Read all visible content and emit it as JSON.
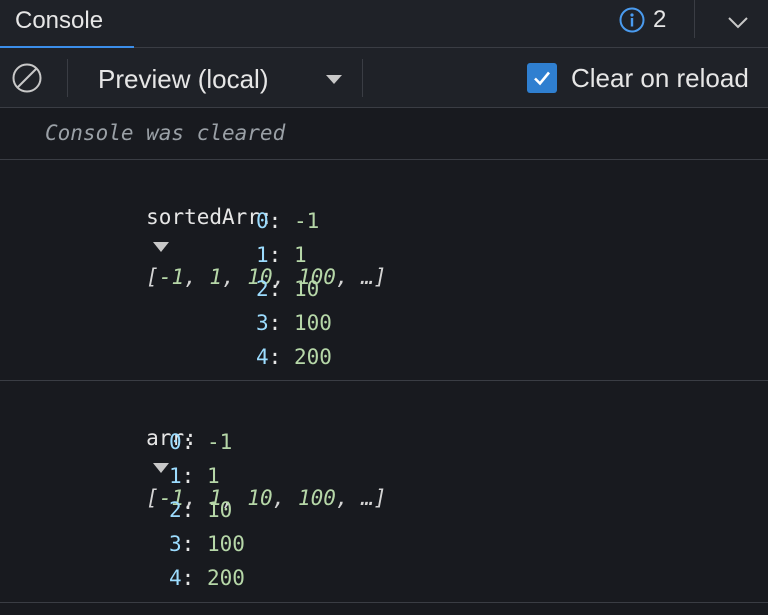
{
  "tabbar": {
    "tab_label": "Console",
    "issues_count": "2",
    "accent_color": "#3b8eea"
  },
  "toolbar": {
    "context_value": "Preview (local)",
    "clear_on_reload_label": "Clear on reload",
    "clear_on_reload_checked": true
  },
  "console": {
    "cleared_message": "Console was cleared",
    "logs": [
      {
        "label": "sortedArr:",
        "preview_open": "[",
        "preview_items": [
          "-1",
          "1",
          "10",
          "100"
        ],
        "preview_tail": "…]",
        "entries": [
          {
            "key": "0",
            "value": "-1"
          },
          {
            "key": "1",
            "value": "1"
          },
          {
            "key": "2",
            "value": "10"
          },
          {
            "key": "3",
            "value": "100"
          },
          {
            "key": "4",
            "value": "200"
          }
        ]
      },
      {
        "label": "arr:",
        "preview_open": "[",
        "preview_items": [
          "-1",
          "1",
          "10",
          "100"
        ],
        "preview_tail": "…]",
        "entries": [
          {
            "key": "0",
            "value": "-1"
          },
          {
            "key": "1",
            "value": "1"
          },
          {
            "key": "2",
            "value": "10"
          },
          {
            "key": "3",
            "value": "100"
          },
          {
            "key": "4",
            "value": "200"
          }
        ]
      }
    ]
  },
  "icons": {
    "info": "info-circle-icon",
    "chevron": "chevron-down-icon",
    "clear": "clear-console-icon",
    "caret": "dropdown-caret-icon",
    "check": "checkmark-icon",
    "expand": "expand-triangle-icon"
  }
}
